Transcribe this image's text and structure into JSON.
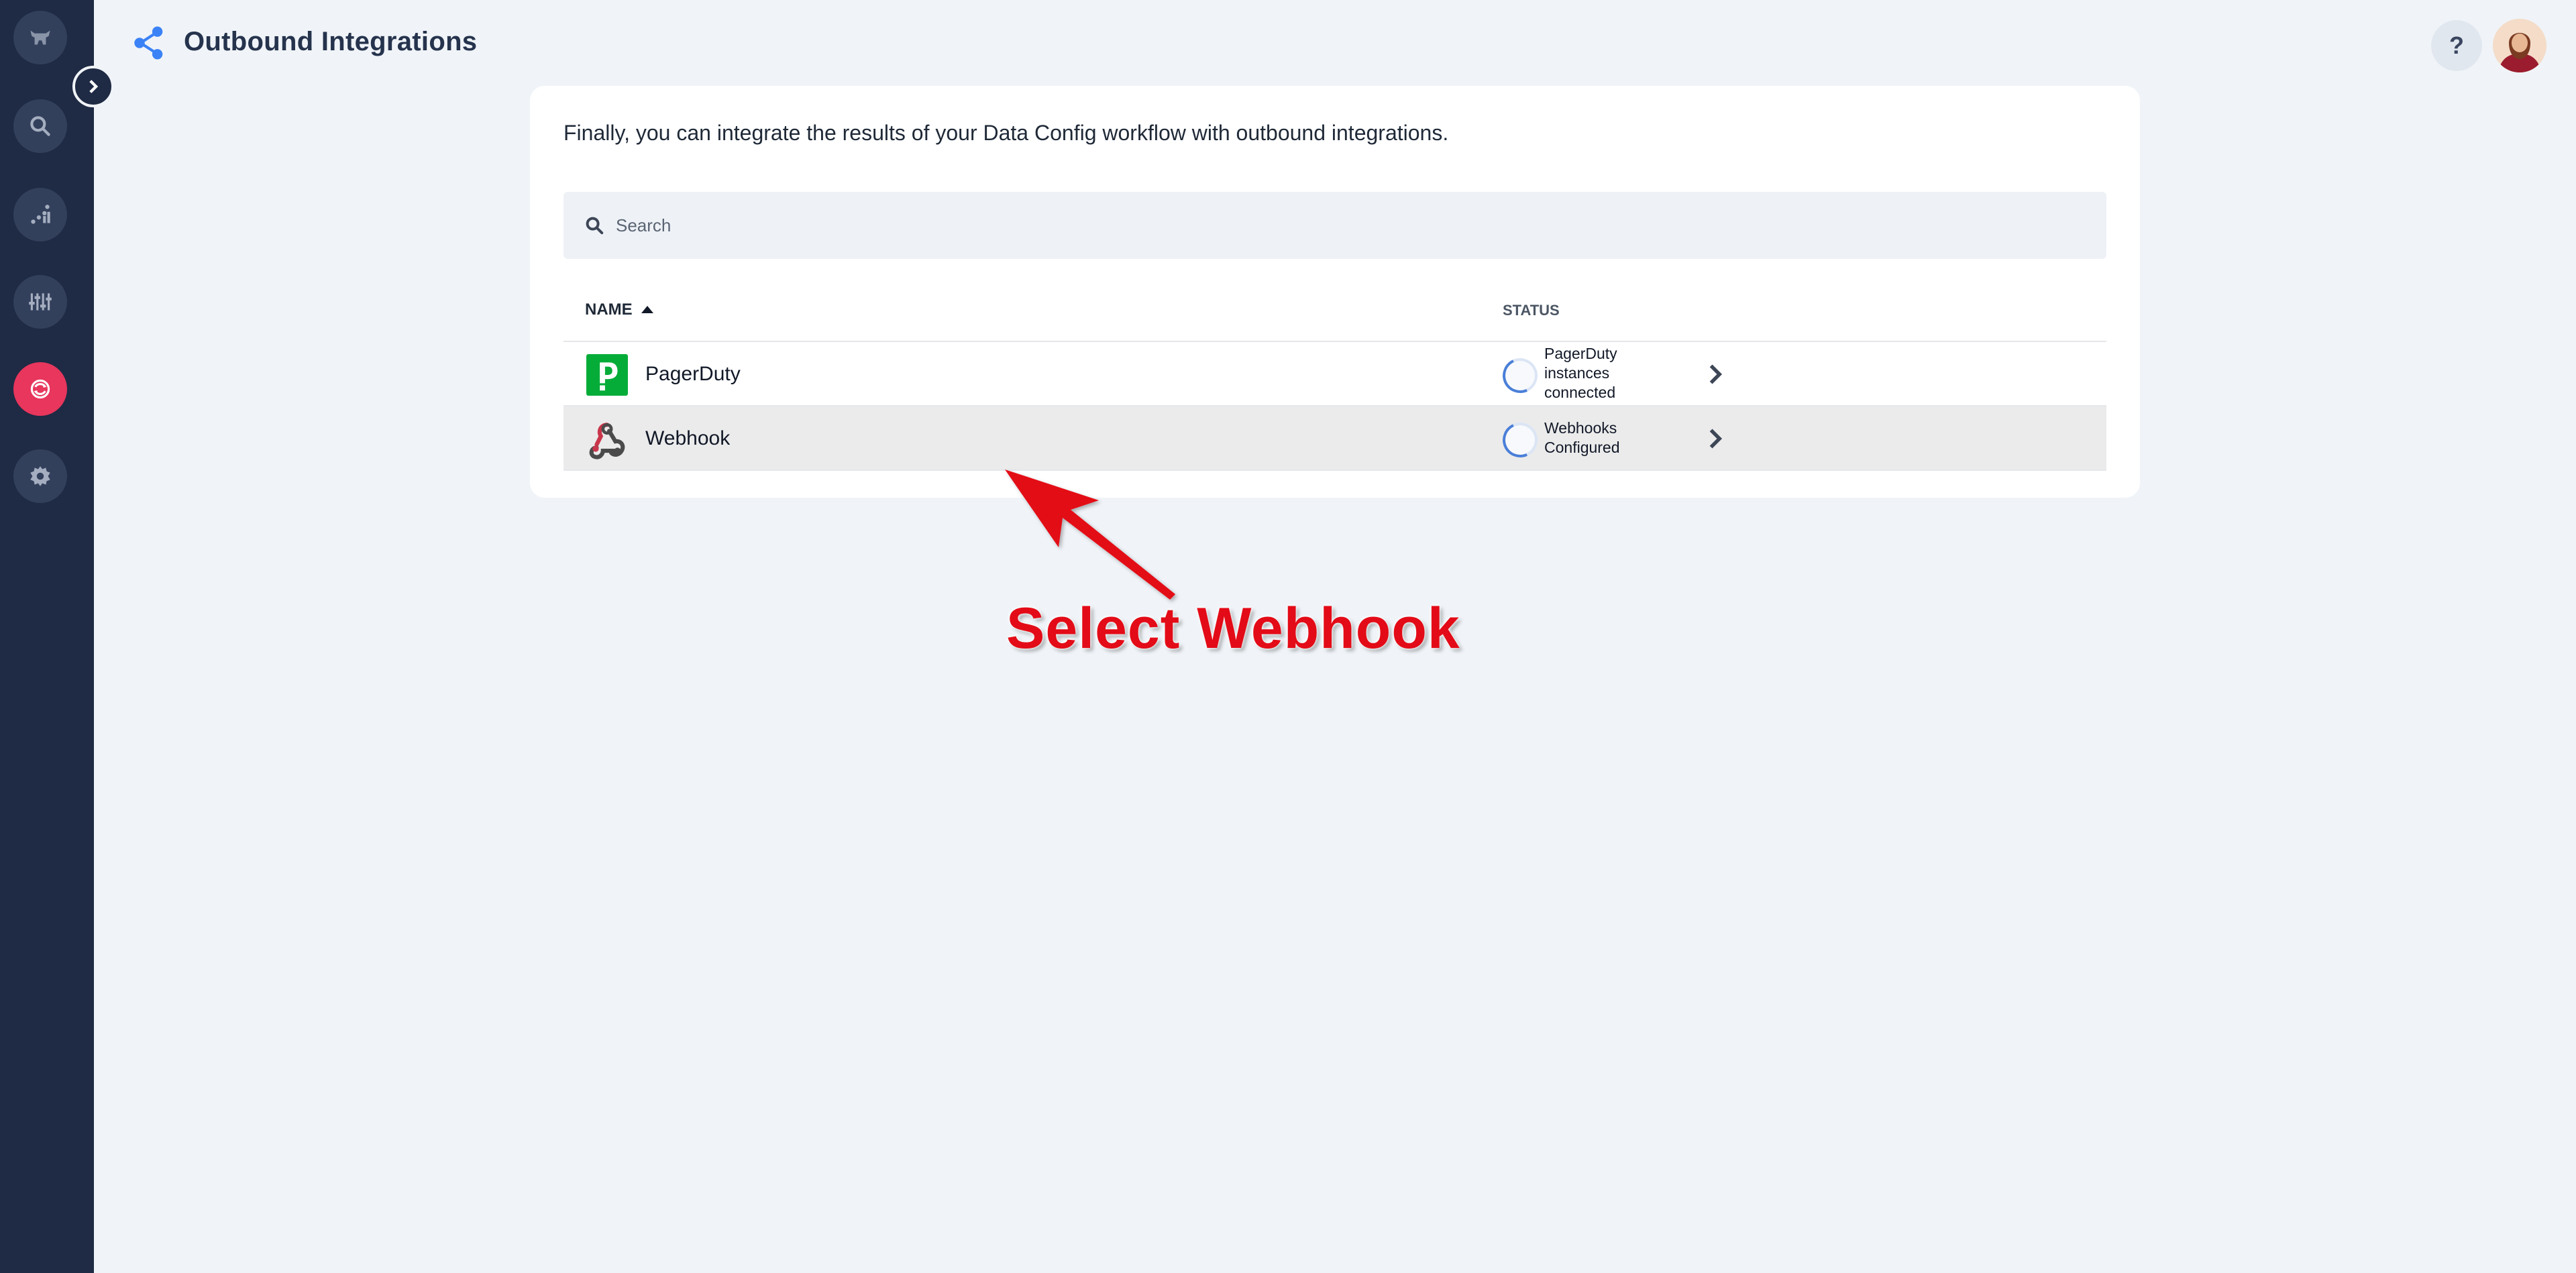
{
  "header": {
    "title": "Outbound Integrations",
    "help_label": "?"
  },
  "card": {
    "intro": "Finally, you can integrate the results of your Data Config workflow with outbound integrations.",
    "search_placeholder": "Search"
  },
  "table": {
    "col_name": "NAME",
    "col_status": "STATUS",
    "rows": [
      {
        "name": "PagerDuty",
        "status_lines": [
          "PagerDuty",
          "instances",
          "connected"
        ],
        "icon": "pagerduty-logo"
      },
      {
        "name": "Webhook",
        "status_lines": [
          "Webhooks",
          "Configured"
        ],
        "icon": "webhook-logo",
        "highlighted": true
      }
    ]
  },
  "annotation": {
    "text": "Select Webhook"
  },
  "colors": {
    "sidebar": "#1f2a44",
    "accent_active": "#e8365d",
    "annotation_red": "#e30b17",
    "pagerduty_green": "#06ac38",
    "share_blue": "#3b82f6"
  }
}
